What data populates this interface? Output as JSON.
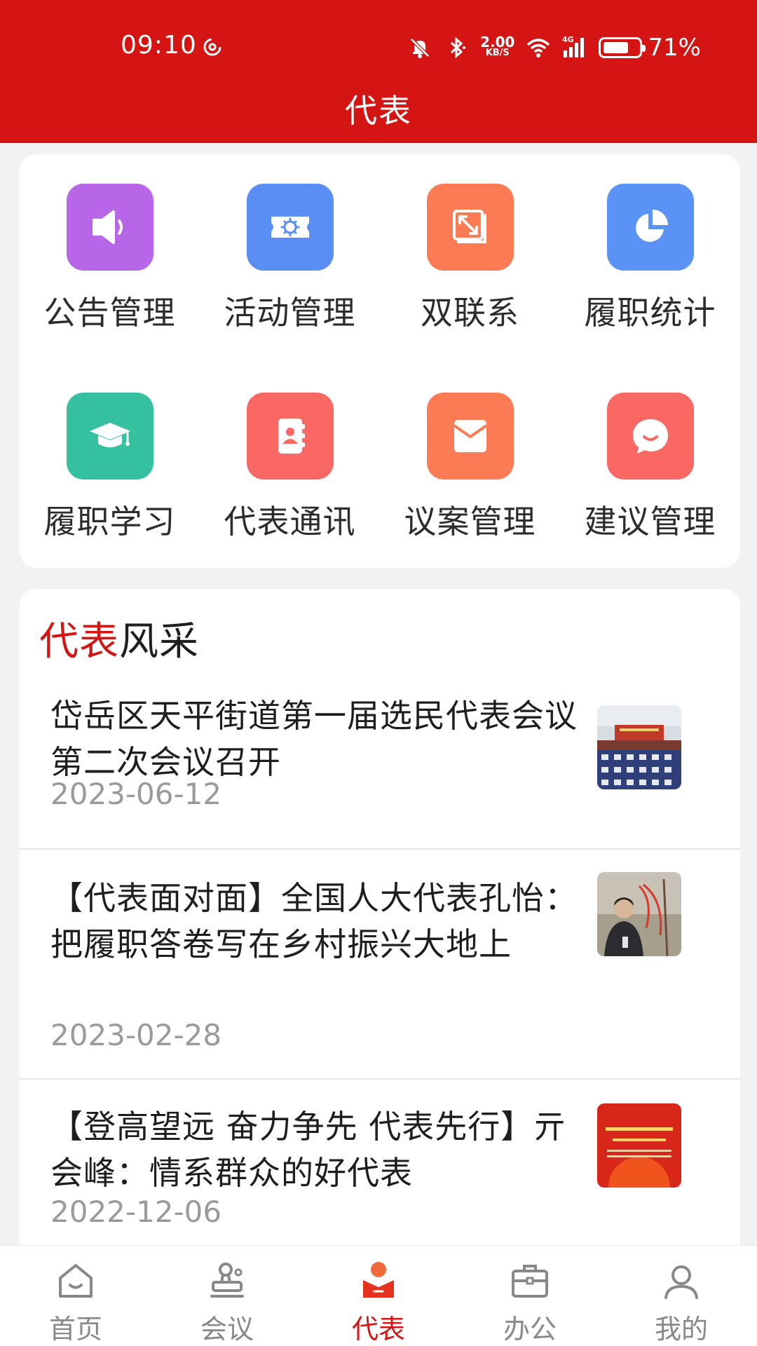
{
  "status_bar": {
    "time": "09:10",
    "net_speed_value": "2.00",
    "net_speed_unit": "KB/S",
    "network_type": "4G",
    "battery_percent": "71%",
    "battery_level": 0.71
  },
  "header": {
    "title": "代表"
  },
  "grid": {
    "items": [
      {
        "label": "公告管理",
        "icon": "speaker-icon",
        "color": "#b866e8"
      },
      {
        "label": "活动管理",
        "icon": "ticket-gear-icon",
        "color": "#5a8ef5"
      },
      {
        "label": "双联系",
        "icon": "expand-icon",
        "color": "#fb7b55"
      },
      {
        "label": "履职统计",
        "icon": "pie-chart-icon",
        "color": "#5a93f5"
      },
      {
        "label": "履职学习",
        "icon": "graduation-cap-icon",
        "color": "#35c0a0"
      },
      {
        "label": "代表通讯",
        "icon": "contact-book-icon",
        "color": "#fa6863"
      },
      {
        "label": "议案管理",
        "icon": "envelope-icon",
        "color": "#fb7b55"
      },
      {
        "label": "建议管理",
        "icon": "chat-bubble-icon",
        "color": "#fa6863"
      }
    ]
  },
  "news": {
    "heading_accent": "代表",
    "heading_rest": "风采",
    "items": [
      {
        "title": "岱岳区天平街道第一届选民代表会议第二次会议召开",
        "date": "2023-06-12"
      },
      {
        "title": "【代表面对面】全国人大代表孔怡：把履职答卷写在乡村振兴大地上",
        "date": "2023-02-28"
      },
      {
        "title": "【登高望远 奋力争先 代表先行】亓会峰：情系群众的好代表",
        "date": "2022-12-06"
      }
    ]
  },
  "bottom_nav": {
    "items": [
      {
        "label": "首页",
        "icon": "home-icon",
        "active": false
      },
      {
        "label": "会议",
        "icon": "meeting-stamp-icon",
        "active": false
      },
      {
        "label": "代表",
        "icon": "representative-icon",
        "active": true
      },
      {
        "label": "办公",
        "icon": "briefcase-icon",
        "active": false
      },
      {
        "label": "我的",
        "icon": "profile-icon",
        "active": false
      }
    ]
  },
  "colors": {
    "primary": "#d51513",
    "inactive_nav": "#888888",
    "date_text": "#9a9a9a"
  }
}
